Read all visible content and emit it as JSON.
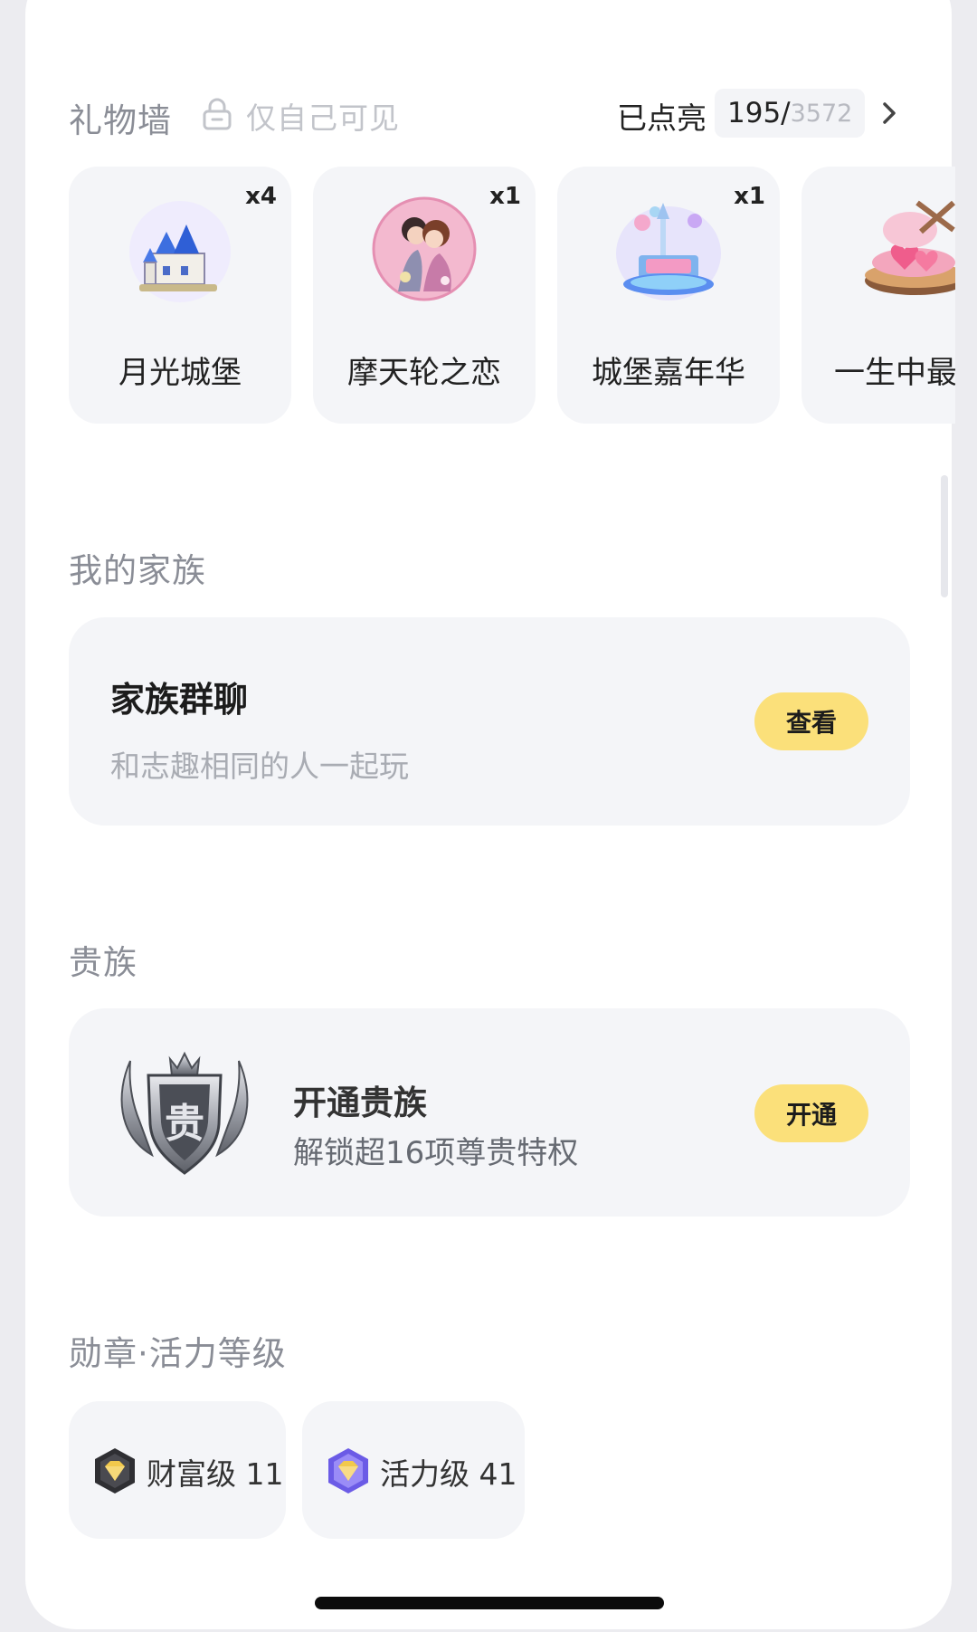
{
  "gift_wall": {
    "title": "礼物墙",
    "privacy": "仅自己可见",
    "lit_label": "已点亮",
    "lit_count": "195/",
    "total_count": "3572",
    "gifts": [
      {
        "qty": "x4",
        "name": "月光城堡",
        "icon": "moonlight-castle-icon"
      },
      {
        "qty": "x1",
        "name": "摩天轮之恋",
        "icon": "ferris-wheel-love-icon"
      },
      {
        "qty": "x1",
        "name": "城堡嘉年华",
        "icon": "castle-carnival-icon"
      },
      {
        "qty": "",
        "name": "一生中最",
        "icon": "lifetime-love-icon"
      }
    ]
  },
  "family": {
    "title": "我的家族",
    "card_name": "家族群聊",
    "card_desc": "和志趣相同的人一起玩",
    "button": "查看"
  },
  "noble": {
    "title": "贵族",
    "card_name": "开通贵族",
    "card_desc": "解锁超16项尊贵特权",
    "button": "开通",
    "badge_char": "贵"
  },
  "medals": {
    "title": "勋章·活力等级",
    "items": [
      {
        "label": "财富级 11",
        "icon": "wealth-level-icon",
        "color": "#f2c94c"
      },
      {
        "label": "活力级 41",
        "icon": "vitality-level-icon",
        "color": "#7b6cf0"
      }
    ]
  }
}
